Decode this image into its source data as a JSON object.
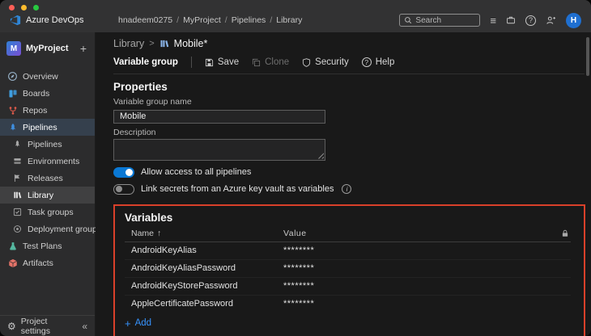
{
  "colors": {
    "accent": "#0078d4",
    "annotation_red": "#d9402a",
    "link_blue": "#3794ff"
  },
  "icons": {
    "list": "≡",
    "gear": "⚙",
    "collapse": "«",
    "sort_asc": "↑",
    "plus": "+",
    "info": "i",
    "help": "?"
  },
  "header": {
    "product": "Azure DevOps",
    "separator": "/",
    "breadcrumb": [
      {
        "label": "hnadeem0275"
      },
      {
        "label": "MyProject"
      },
      {
        "label": "Pipelines"
      },
      {
        "label": "Library"
      }
    ],
    "search": {
      "placeholder": "Search"
    },
    "avatar_initial": "H"
  },
  "sidebar": {
    "project": {
      "name": "MyProject",
      "initial": "M"
    },
    "items": [
      {
        "label": "Overview",
        "icon": "compass"
      },
      {
        "label": "Boards",
        "icon": "boards"
      },
      {
        "label": "Repos",
        "icon": "branch"
      },
      {
        "label": "Pipelines",
        "icon": "rocket"
      },
      {
        "label": "Pipelines",
        "icon": "rocket"
      },
      {
        "label": "Environments",
        "icon": "server"
      },
      {
        "label": "Releases",
        "icon": "flag"
      },
      {
        "label": "Library",
        "icon": "books"
      },
      {
        "label": "Task groups",
        "icon": "checklist"
      },
      {
        "label": "Deployment groups",
        "icon": "target"
      },
      {
        "label": "Test Plans",
        "icon": "beaker"
      },
      {
        "label": "Artifacts",
        "icon": "package"
      }
    ],
    "footer": {
      "settings_label": "Project settings"
    }
  },
  "main": {
    "breadcrumb": {
      "parent": "Library",
      "separator": ">",
      "current": "Mobile*"
    },
    "toolbar": {
      "tab": "Variable group",
      "save": "Save",
      "clone": "Clone",
      "security": "Security",
      "help": "Help"
    },
    "properties": {
      "title": "Properties",
      "name_label": "Variable group name",
      "name_value": "Mobile",
      "description_label": "Description",
      "description_value": "",
      "toggles": [
        {
          "label": "Allow access to all pipelines",
          "on": true
        },
        {
          "label": "Link secrets from an Azure key vault as variables",
          "on": false
        }
      ]
    },
    "variables": {
      "title": "Variables",
      "columns": {
        "name": "Name",
        "value": "Value"
      },
      "rows": [
        {
          "name": "AndroidKeyAlias",
          "value": "********"
        },
        {
          "name": "AndroidKeyAliasPassword",
          "value": "********"
        },
        {
          "name": "AndroidKeyStorePassword",
          "value": "********"
        },
        {
          "name": "AppleCertificatePassword",
          "value": "********"
        }
      ],
      "add": "Add"
    }
  }
}
